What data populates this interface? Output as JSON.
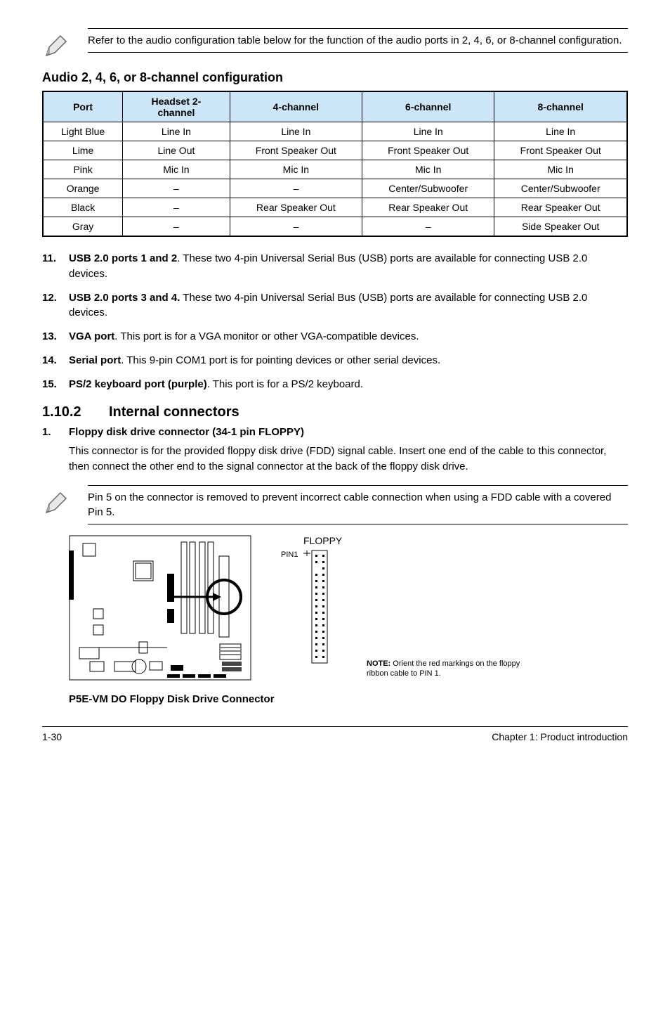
{
  "note1": "Refer to the audio configuration table below for the function of the audio ports in 2, 4, 6, or 8-channel configuration.",
  "audio_heading": "Audio 2, 4, 6, or 8-channel configuration",
  "table": {
    "headers": [
      "Port",
      "Headset 2-channel",
      "4-channel",
      "6-channel",
      "8-channel"
    ],
    "rows": [
      [
        "Light Blue",
        "Line In",
        "Line In",
        "Line In",
        "Line In"
      ],
      [
        "Lime",
        "Line Out",
        "Front Speaker Out",
        "Front Speaker Out",
        "Front Speaker Out"
      ],
      [
        "Pink",
        "Mic In",
        "Mic In",
        "Mic In",
        "Mic In"
      ],
      [
        "Orange",
        "–",
        "–",
        "Center/Subwoofer",
        "Center/Subwoofer"
      ],
      [
        "Black",
        "–",
        "Rear Speaker Out",
        "Rear Speaker Out",
        "Rear Speaker Out"
      ],
      [
        "Gray",
        "–",
        "–",
        "–",
        "Side Speaker Out"
      ]
    ]
  },
  "items": [
    {
      "num": "11.",
      "bold": "USB 2.0 ports 1 and 2",
      "text": ". These two 4-pin Universal Serial Bus (USB) ports are available for connecting USB 2.0 devices."
    },
    {
      "num": "12.",
      "bold": "USB 2.0 ports 3 and 4.",
      "text": " These two 4-pin Universal Serial Bus (USB) ports are available for connecting USB 2.0 devices."
    },
    {
      "num": "13.",
      "bold": "VGA port",
      "text": ". This port is for a VGA monitor or other VGA-compatible devices."
    },
    {
      "num": "14.",
      "bold": "Serial port",
      "text": ". This 9-pin COM1 port is for pointing devices or other serial devices."
    },
    {
      "num": "15.",
      "bold": "PS/2 keyboard port (purple)",
      "text": ". This port is for a PS/2 keyboard."
    }
  ],
  "section": {
    "no": "1.10.2",
    "title": "Internal connectors"
  },
  "sub1": {
    "num": "1.",
    "title": "Floppy disk drive connector (34-1 pin FLOPPY)"
  },
  "sub1_text": "This connector is for the provided floppy disk drive (FDD) signal cable. Insert one end of the cable to this connector, then connect the other end to the signal connector at the back of the floppy disk drive.",
  "note2": "Pin 5 on the connector is removed to prevent incorrect cable connection when using a FDD cable with a covered Pin 5.",
  "floppy_label": "FLOPPY",
  "pin1": "PIN1",
  "orient_bold": "NOTE:",
  "orient_text": " Orient the red markings on the floppy ribbon cable to PIN 1.",
  "diag_caption": "P5E-VM DO Floppy Disk Drive Connector",
  "footer_left": "1-30",
  "footer_right": "Chapter 1: Product introduction"
}
